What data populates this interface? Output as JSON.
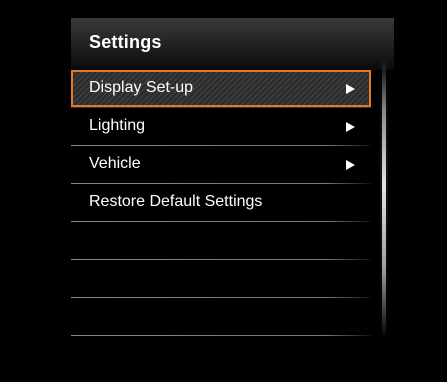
{
  "header": {
    "title": "Settings"
  },
  "menu": {
    "items": [
      {
        "label": "Display Set-up",
        "has_submenu": true,
        "selected": true
      },
      {
        "label": "Lighting",
        "has_submenu": true,
        "selected": false
      },
      {
        "label": "Vehicle",
        "has_submenu": true,
        "selected": false
      },
      {
        "label": "Restore Default Settings",
        "has_submenu": false,
        "selected": false
      },
      {
        "label": "",
        "has_submenu": false,
        "selected": false
      },
      {
        "label": "",
        "has_submenu": false,
        "selected": false
      },
      {
        "label": "",
        "has_submenu": false,
        "selected": false
      }
    ]
  },
  "icons": {
    "submenu": "triangle-right-icon"
  },
  "colors": {
    "accent": "#e3782b",
    "background": "#000000",
    "text": "#ffffff",
    "separator": "#969696"
  }
}
